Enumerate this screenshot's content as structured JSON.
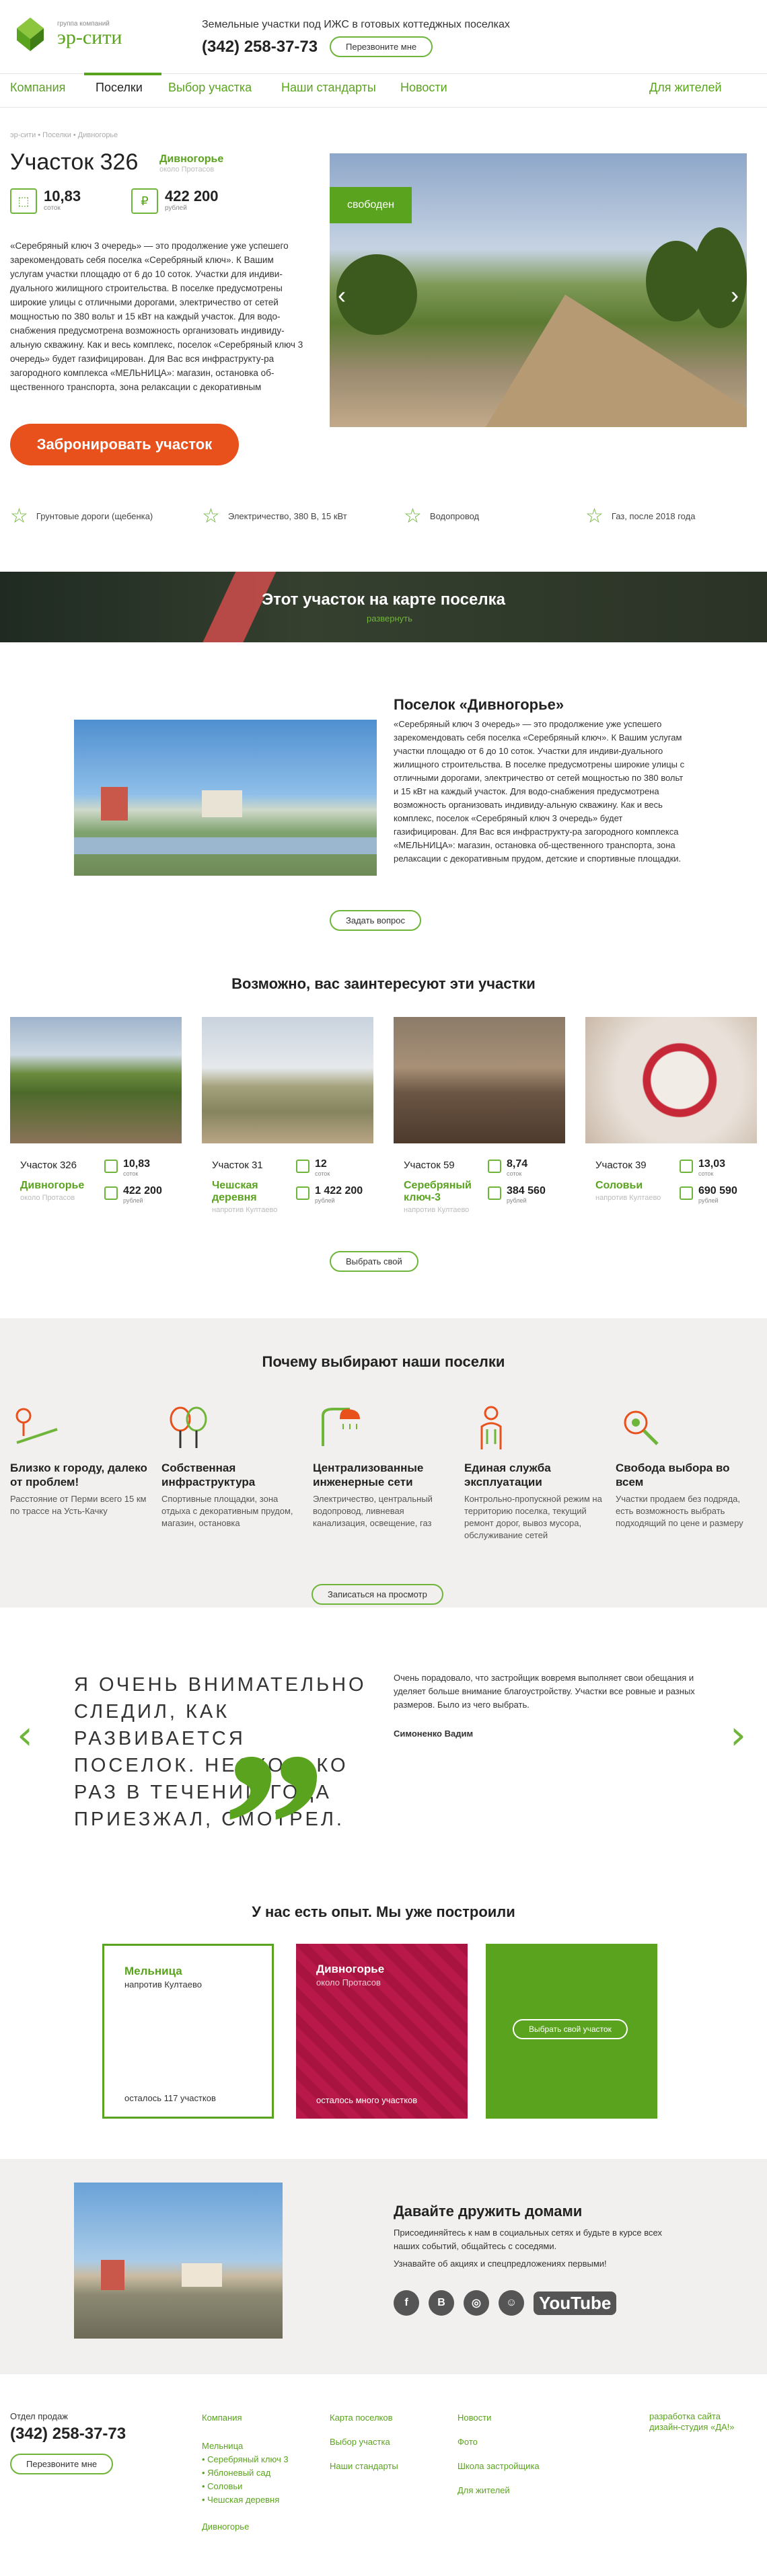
{
  "header": {
    "logo_small": "группа компаний",
    "logo_big": "эр-сити",
    "tagline": "Земельные участки под ИЖС в готовых коттеджных поселках",
    "phone": "(342) 258-37-73",
    "call_label": "Перезвоните мне"
  },
  "nav": {
    "items": [
      "Компания",
      "Поселки",
      "Выбор участка",
      "Наши стандарты",
      "Новости"
    ],
    "right": "Для жителей"
  },
  "plot": {
    "breadcrumb": "эр-сити  •  Поселки  •  Дивногорье",
    "title": "Участок 326",
    "location": "Дивногорье",
    "location_sub": "около Протасов",
    "area": "10,83",
    "area_unit": "соток",
    "price": "422 200",
    "price_unit": "рублей",
    "status_badge": "свободен",
    "description": "«Серебряный ключ 3 очередь» — это продолжение уже успешего зарекомендовать себя поселка «Серебряный ключ». К Вашим услугам участки площадю от 6 до 10 соток. Участки для индиви-дуального жилищного строительства. В поселке предусмотрены широкие улицы с отличными дорогами, электричество от сетей мощностью по 380 вольт и 15 кВт на каждый участок. Для водо-снабжения предусмотрена возможность организовать индивиду-альную скважину. Как и весь комплекс, поселок «Серебряный ключ 3 очередь» будет газифицирован. Для Вас вся инфраструкту-ра загородного комплекса «МЕЛЬНИЦА»: магазин, остановка об-щественного транспорта, зона релаксации с декоративным",
    "book_label": "Забронировать участок",
    "features": [
      "Грунтовые дороги (щебенка)",
      "Электричество, 380 В, 15 кВт",
      "Водопровод",
      "Газ, после 2018 года"
    ]
  },
  "mapband": {
    "title": "Этот участок на карте поселка",
    "sub": "развернуть"
  },
  "settlement": {
    "title": "Поселок «Дивногорье»",
    "text": "«Серебряный ключ 3 очередь» — это продолжение уже успешего зарекомендовать себя поселка «Серебряный ключ». К Вашим услугам участки площадю от 6 до 10 соток. Участки для индиви-дуального жилищного строительства. В поселке предусмотрены широкие улицы с отличными дорогами, электричество от сетей мощностью по 380 вольт и 15 кВт на каждый участок. Для водо-снабжения предусмотрена возможность организовать индивиду-альную скважину. Как и весь комплекс, поселок «Серебряный ключ 3 очередь» будет газифицирован. Для Вас вся инфраструкту-ра загородного комплекса «МЕЛЬНИЦА»: магазин, остановка об-щественного транспорта, зона релаксации с декоративным прудом, детские и спортивные площадки.",
    "ask_label": "Задать вопрос"
  },
  "related": {
    "title": "Возможно, вас заинтересуют эти участки",
    "choose_label": "Выбрать свой",
    "cards": [
      {
        "name": "Участок 326",
        "loc": "Дивногорье",
        "loc_sub": "около Протасов",
        "area": "10,83",
        "area_unit": "соток",
        "price": "422 200",
        "price_unit": "рублей"
      },
      {
        "name": "Участок 31",
        "loc": "Чешская деревня",
        "loc_sub": "напротив Култаево",
        "area": "12",
        "area_unit": "соток",
        "price": "1 422 200",
        "price_unit": "рублей"
      },
      {
        "name": "Участок 59",
        "loc": "Серебряный ключ-3",
        "loc_sub": "напротив Култаево",
        "area": "8,74",
        "area_unit": "соток",
        "price": "384 560",
        "price_unit": "рублей"
      },
      {
        "name": "Участок 39",
        "loc": "Соловьи",
        "loc_sub": "напротив Култаево",
        "area": "13,03",
        "area_unit": "соток",
        "price": "690 590",
        "price_unit": "рублей"
      }
    ]
  },
  "why": {
    "title": "Почему выбирают наши поселки",
    "signup_label": "Записаться на просмотр",
    "items": [
      {
        "title": "Близко к городу, далеко от проблем!",
        "desc": "Расстояние от Перми всего 15 км по трассе на Усть-Качку"
      },
      {
        "title": "Собственная инфраструктура",
        "desc": "Спортивные площадки, зона отдыха с декоративным прудом, магазин, остановка"
      },
      {
        "title": "Централизованные инженерные сети",
        "desc": "Электричество, центральный водопровод, ливневая канализация, освещение, газ"
      },
      {
        "title": "Единая служба эксплуатации",
        "desc": "Контрольно-пропускной режим на территорию поселка, текущий ремонт дорог, вывоз мусора, обслуживание сетей"
      },
      {
        "title": "Свобода выбора во всем",
        "desc": "Участки продаем без подряда, есть возможность выбрать подходящий по цене и размеру"
      }
    ]
  },
  "testimonial": {
    "quote": "Я очень внимательно следил, как развивается поселок. Несколько раз в течении года приезжал, смотрел.",
    "text": "Очень порадовало, что застройщик вовремя выполняет свои обещания и уделяет больше внимание благоустройству. Участки все ровные и разных размеров. Было из чего выбрать.",
    "author": "Симоненко Вадим"
  },
  "experience": {
    "title": "У нас есть опыт. Мы уже построили",
    "cards": [
      {
        "name": "Мельница",
        "sub": "напротив Култаево",
        "count": "осталось 117 участков"
      },
      {
        "name": "Дивногорье",
        "sub": "около Протасов",
        "count": "осталось много участков"
      }
    ],
    "choose_label": "Выбрать свой участок"
  },
  "friends": {
    "title": "Давайте дружить домами",
    "text": "Присоединяйтесь к нам в социальных сетях и будьте в курсе всех наших событий, общайтесь с соседями.",
    "sub": "Узнавайте об акциях и спецпредложениях первыми!",
    "youtube": "YouTube"
  },
  "footer": {
    "sales_label": "Отдел продаж",
    "phone": "(342) 258-37-73",
    "call_label": "Перезвоните мне",
    "col1": [
      "Компания",
      "Мельница",
      "• Серебряный ключ 3",
      "• Яблоневый сад",
      "• Соловьи",
      "• Чешская деревня",
      "Дивногорье"
    ],
    "col2": [
      "Карта поселков",
      "Выбор участка",
      "Наши стандарты"
    ],
    "col3": [
      "Новости",
      "Фото",
      "Школа застройщика",
      "Для жителей"
    ],
    "studio_line1": "разработка сайта",
    "studio_line2": "дизайн-студия «ДА!»"
  },
  "colors": {
    "accent": "#5aa31e",
    "cta": "#e8501c",
    "crimson": "#b8194a"
  }
}
